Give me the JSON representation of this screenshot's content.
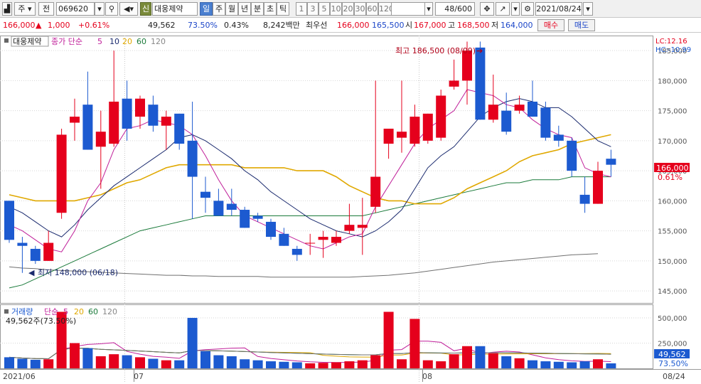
{
  "toolbar": {
    "market": "주",
    "prev_label": "전",
    "code": "069620",
    "stock_name": "대웅제약",
    "new_badge": "신",
    "periods": [
      "일",
      "주",
      "월",
      "년",
      "분",
      "초",
      "틱"
    ],
    "selected_period": "일",
    "counts": [
      "1",
      "3",
      "5",
      "10",
      "20",
      "30",
      "60",
      "120"
    ],
    "page_count": "48/600",
    "date": "2021/08/24"
  },
  "info": {
    "price": "166,000",
    "change": "1,000",
    "change_pct": "+0.61%",
    "volume": "49,562",
    "vol_ratio": "73.50%",
    "turnover_pct": "0.43%",
    "amount": "8,242백만",
    "best_label": "최우선",
    "best_ask": "166,000",
    "best_bid": "165,500",
    "open_label": "시",
    "open": "167,000",
    "high_label": "고",
    "high": "168,500",
    "low_label": "저",
    "low": "164,000",
    "buy_label": "매수",
    "sell_label": "매도"
  },
  "price_panel": {
    "name_tag": "대웅제약",
    "ma_label": "종가 단순",
    "ma_periods": [
      "5",
      "10",
      "20",
      "60",
      "120"
    ],
    "lc": "LC:12.16",
    "hc": "HC:-10.99",
    "max_label": "최고 186,500 (08/09)",
    "min_label": "최저 148,000 (06/18)",
    "last_price_tag": "166,000",
    "last_pct_tag": "0.61%"
  },
  "volume_panel": {
    "label": "거래량",
    "ma_label": "단순",
    "ma_periods": [
      "5",
      "20",
      "60",
      "120"
    ],
    "current": "49,562주(73.50%)",
    "last_tag": "49,562",
    "last_pct": "73.50%"
  },
  "x_labels": [
    "2021/06",
    "07",
    "08",
    "08/24"
  ],
  "colors": {
    "up": "#e5001c",
    "down": "#1c5ad0",
    "ma5": "#c0209a",
    "ma10": "#1a2a6e",
    "ma20": "#e0a800",
    "ma60": "#1a7a3a",
    "ma120": "#707070"
  },
  "chart_data": {
    "type": "candlestick",
    "y_ticks": [
      145000,
      150000,
      155000,
      160000,
      165000,
      170000,
      175000,
      180000,
      185000
    ],
    "ylim": [
      143000,
      187500
    ],
    "volume_ticks": [
      250000,
      500000
    ],
    "volume_ylim": [
      0,
      620000
    ],
    "candles": [
      {
        "o": 160000,
        "h": 160000,
        "l": 153000,
        "c": 153500
      },
      {
        "o": 153000,
        "h": 154000,
        "l": 148000,
        "c": 152500
      },
      {
        "o": 152000,
        "h": 152500,
        "l": 149500,
        "c": 150000
      },
      {
        "o": 150000,
        "h": 155000,
        "l": 150000,
        "c": 153000
      },
      {
        "o": 158000,
        "h": 172000,
        "l": 157000,
        "c": 171000
      },
      {
        "o": 173000,
        "h": 177000,
        "l": 170000,
        "c": 174000
      },
      {
        "o": 176000,
        "h": 181500,
        "l": 168500,
        "c": 168500
      },
      {
        "o": 169000,
        "h": 175000,
        "l": 162000,
        "c": 171500
      },
      {
        "o": 169500,
        "h": 185000,
        "l": 169000,
        "c": 176500
      },
      {
        "o": 177000,
        "h": 180000,
        "l": 170000,
        "c": 172000
      },
      {
        "o": 174000,
        "h": 177500,
        "l": 172000,
        "c": 177000
      },
      {
        "o": 176000,
        "h": 177500,
        "l": 171500,
        "c": 172500
      },
      {
        "o": 172500,
        "h": 175000,
        "l": 168500,
        "c": 174000
      },
      {
        "o": 174500,
        "h": 174500,
        "l": 168500,
        "c": 169500
      },
      {
        "o": 170000,
        "h": 176500,
        "l": 157000,
        "c": 164000
      },
      {
        "o": 161500,
        "h": 164000,
        "l": 158000,
        "c": 160500
      },
      {
        "o": 160000,
        "h": 162000,
        "l": 157500,
        "c": 157500
      },
      {
        "o": 159500,
        "h": 162000,
        "l": 157500,
        "c": 158500
      },
      {
        "o": 158500,
        "h": 159000,
        "l": 155500,
        "c": 155500
      },
      {
        "o": 157500,
        "h": 158000,
        "l": 156500,
        "c": 157000
      },
      {
        "o": 156500,
        "h": 157000,
        "l": 153500,
        "c": 154000
      },
      {
        "o": 154500,
        "h": 155500,
        "l": 152500,
        "c": 152500
      },
      {
        "o": 152000,
        "h": 152500,
        "l": 150000,
        "c": 151000
      },
      {
        "o": 153000,
        "h": 154500,
        "l": 151000,
        "c": 153000
      },
      {
        "o": 153500,
        "h": 155000,
        "l": 150500,
        "c": 154000
      },
      {
        "o": 153000,
        "h": 155000,
        "l": 152500,
        "c": 154000
      },
      {
        "o": 155000,
        "h": 159500,
        "l": 154500,
        "c": 156000
      },
      {
        "o": 155500,
        "h": 160500,
        "l": 151000,
        "c": 156000
      },
      {
        "o": 159000,
        "h": 180000,
        "l": 158000,
        "c": 164000
      },
      {
        "o": 169500,
        "h": 170500,
        "l": 167000,
        "c": 172000
      },
      {
        "o": 170500,
        "h": 180000,
        "l": 168000,
        "c": 171500
      },
      {
        "o": 169500,
        "h": 176000,
        "l": 169000,
        "c": 174000
      },
      {
        "o": 170000,
        "h": 174500,
        "l": 169500,
        "c": 174500
      },
      {
        "o": 170500,
        "h": 178500,
        "l": 170000,
        "c": 177500
      },
      {
        "o": 179000,
        "h": 183500,
        "l": 178500,
        "c": 180000
      },
      {
        "o": 180000,
        "h": 186500,
        "l": 176000,
        "c": 185000
      },
      {
        "o": 185500,
        "h": 186500,
        "l": 173500,
        "c": 173500
      },
      {
        "o": 173500,
        "h": 181000,
        "l": 173000,
        "c": 176000
      },
      {
        "o": 175000,
        "h": 178000,
        "l": 171000,
        "c": 171500
      },
      {
        "o": 175000,
        "h": 177500,
        "l": 174500,
        "c": 176000
      },
      {
        "o": 176500,
        "h": 180000,
        "l": 174000,
        "c": 174000
      },
      {
        "o": 175500,
        "h": 176500,
        "l": 170000,
        "c": 170500
      },
      {
        "o": 171000,
        "h": 172500,
        "l": 169000,
        "c": 170000
      },
      {
        "o": 170000,
        "h": 170500,
        "l": 164000,
        "c": 165000
      },
      {
        "o": 161000,
        "h": 164000,
        "l": 158000,
        "c": 159500
      },
      {
        "o": 159500,
        "h": 166500,
        "l": 159500,
        "c": 165000
      },
      {
        "o": 167000,
        "h": 168500,
        "l": 164000,
        "c": 166000
      }
    ],
    "volumes": [
      110000,
      95000,
      85000,
      90000,
      560000,
      250000,
      200000,
      120000,
      140000,
      130000,
      110000,
      95000,
      80000,
      80000,
      500000,
      170000,
      130000,
      120000,
      90000,
      80000,
      70000,
      65000,
      60000,
      50000,
      55000,
      60000,
      70000,
      80000,
      130000,
      560000,
      90000,
      490000,
      80000,
      70000,
      140000,
      220000,
      220000,
      150000,
      120000,
      100000,
      80000,
      70000,
      65000,
      60000,
      70000,
      90000,
      49562
    ],
    "ma5": [
      156000,
      155000,
      153500,
      152000,
      151500,
      155000,
      160000,
      163000,
      168500,
      172000,
      172500,
      173500,
      173000,
      172500,
      171000,
      167500,
      163500,
      160000,
      157500,
      156500,
      155500,
      154500,
      153500,
      152500,
      152000,
      153000,
      154000,
      154500,
      159000,
      162500,
      166000,
      169500,
      172000,
      173500,
      175000,
      178500,
      178000,
      177500,
      176000,
      175500,
      173500,
      172000,
      171000,
      170500,
      165500,
      164500,
      164000
    ],
    "ma10": [
      159000,
      158000,
      156500,
      155000,
      154000,
      156000,
      158500,
      160500,
      162500,
      164000,
      165500,
      167000,
      168500,
      170500,
      171000,
      170000,
      168500,
      167000,
      165000,
      163500,
      161500,
      160000,
      158500,
      157000,
      156000,
      155000,
      154500,
      154000,
      155000,
      156500,
      158500,
      162000,
      165500,
      167500,
      169000,
      171500,
      174000,
      175500,
      176500,
      177000,
      176500,
      175500,
      175500,
      174000,
      172000,
      170000,
      169000
    ],
    "ma20": [
      161000,
      160500,
      160000,
      160000,
      160000,
      160000,
      160500,
      161000,
      162000,
      163000,
      163500,
      164500,
      165500,
      166000,
      166000,
      166000,
      166000,
      166000,
      165500,
      165500,
      165500,
      165500,
      165000,
      165000,
      165000,
      164000,
      162500,
      161500,
      160500,
      160000,
      160000,
      159500,
      159500,
      159500,
      160500,
      162000,
      163000,
      164000,
      165000,
      166500,
      167500,
      168000,
      168500,
      169500,
      170000,
      170500,
      171000
    ],
    "ma60": [
      145500,
      146000,
      147000,
      148000,
      149000,
      150000,
      151000,
      152000,
      153000,
      154000,
      155000,
      155500,
      156000,
      156500,
      157000,
      157500,
      157500,
      157500,
      157500,
      157500,
      157500,
      157500,
      157500,
      157500,
      157500,
      157500,
      157500,
      157500,
      158000,
      158500,
      159000,
      159500,
      160000,
      160500,
      161000,
      161500,
      162000,
      162500,
      163000,
      163000,
      163500,
      163500,
      163500,
      164000,
      164000,
      164000,
      164000
    ],
    "ma120": [
      149000,
      148800,
      148700,
      148500,
      148400,
      148300,
      148200,
      148100,
      148000,
      147900,
      147800,
      147700,
      147600,
      147600,
      147500,
      147500,
      147400,
      147400,
      147400,
      147400,
      147300,
      147300,
      147300,
      147300,
      147300,
      147300,
      147300,
      147400,
      147500,
      147600,
      147800,
      148000,
      148300,
      148600,
      148900,
      149200,
      149500,
      149800,
      150000,
      150200,
      150400,
      150600,
      150800,
      151000,
      151100,
      151200
    ]
  }
}
